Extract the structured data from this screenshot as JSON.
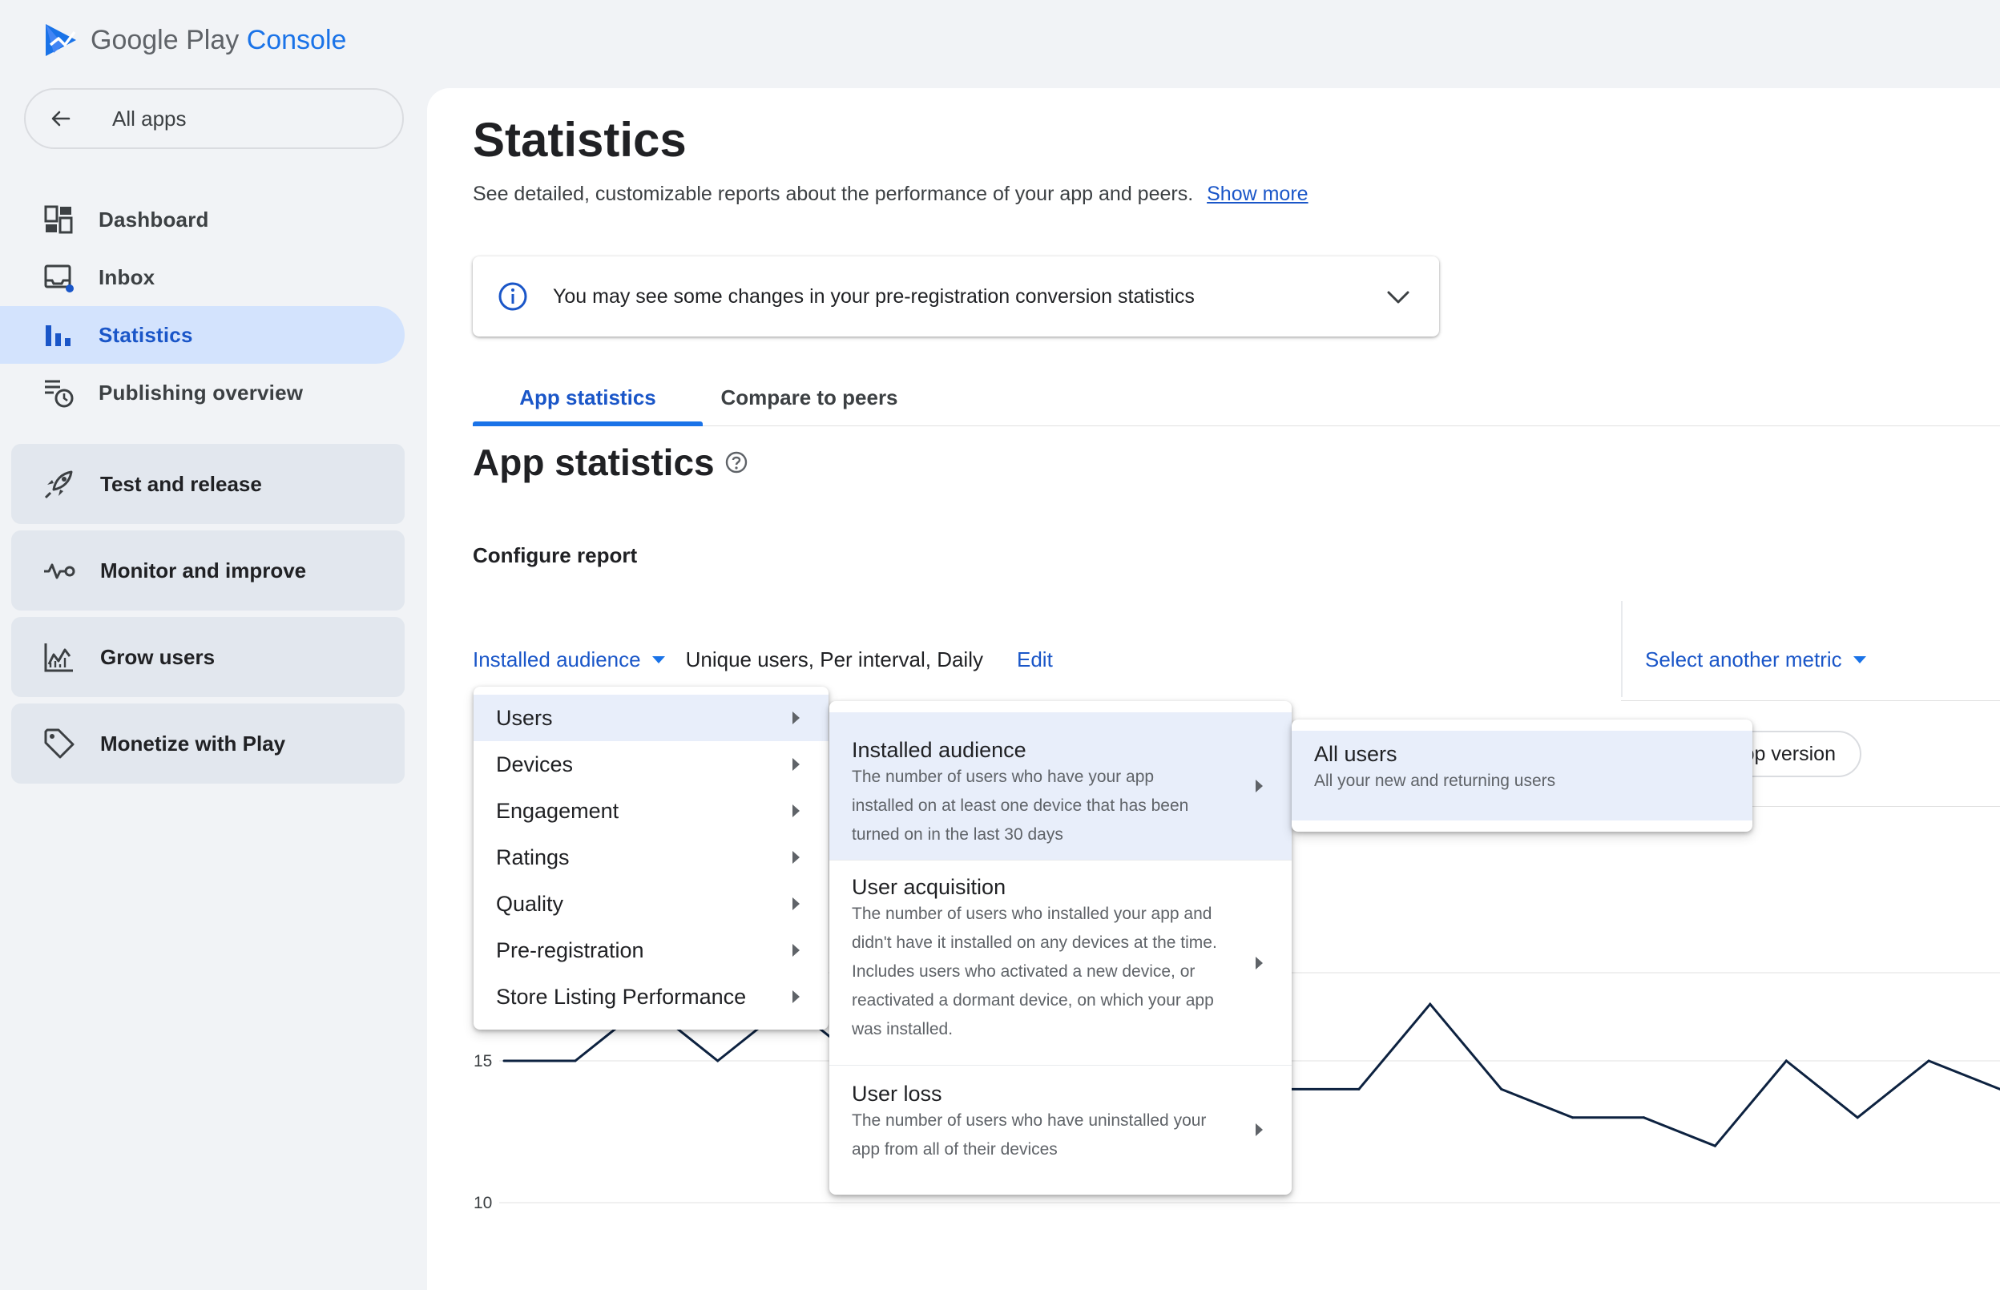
{
  "brand": {
    "google_play": "Google Play",
    "console": "Console"
  },
  "sidebar": {
    "all_apps": "All apps",
    "items": [
      {
        "label": "Dashboard"
      },
      {
        "label": "Inbox"
      },
      {
        "label": "Statistics"
      },
      {
        "label": "Publishing overview"
      }
    ],
    "groups": [
      {
        "label": "Test and release"
      },
      {
        "label": "Monitor and improve"
      },
      {
        "label": "Grow users"
      },
      {
        "label": "Monetize with Play"
      }
    ]
  },
  "page": {
    "title": "Statistics",
    "description": "See detailed, customizable reports about the performance of your app and peers.",
    "show_more": "Show more",
    "banner": "You may see some changes in your pre-registration conversion statistics",
    "tabs": [
      "App statistics",
      "Compare to peers"
    ],
    "section_title": "App statistics",
    "configure_report": "Configure report",
    "metric": "Installed audience",
    "metric_desc": "Unique users, Per interval, Daily",
    "edit": "Edit",
    "select_another_metric": "Select another metric",
    "chip_partial": "pp version"
  },
  "menu_categories": [
    "Users",
    "Devices",
    "Engagement",
    "Ratings",
    "Quality",
    "Pre-registration",
    "Store Listing Performance"
  ],
  "menu_metrics": [
    {
      "title": "Installed audience",
      "desc": "The number of users who have your app installed on at least one device that has been turned on in the last 30 days"
    },
    {
      "title": "User acquisition",
      "desc": "The number of users who installed your app and didn't have it installed on any devices at the time. Includes users who activated a new device, or reactivated a dormant device, on which your app was installed."
    },
    {
      "title": "User loss",
      "desc": "The number of users who have uninstalled your app from all of their devices"
    }
  ],
  "menu_audience": {
    "title": "All users",
    "desc": "All your new and returning users"
  },
  "colors": {
    "accent": "#1a73e8",
    "active_nav_bg": "#d3e3fd",
    "line": "#0d2240"
  },
  "chart_data": {
    "type": "line",
    "y_ticks": [
      10,
      15
    ],
    "series": [
      {
        "values": [
          15,
          15,
          17,
          15,
          17,
          15,
          15,
          15,
          15,
          15,
          15,
          14,
          14,
          17,
          14,
          13,
          13,
          12,
          15,
          13,
          15,
          14
        ]
      }
    ],
    "ylim": [
      10,
      19
    ]
  }
}
